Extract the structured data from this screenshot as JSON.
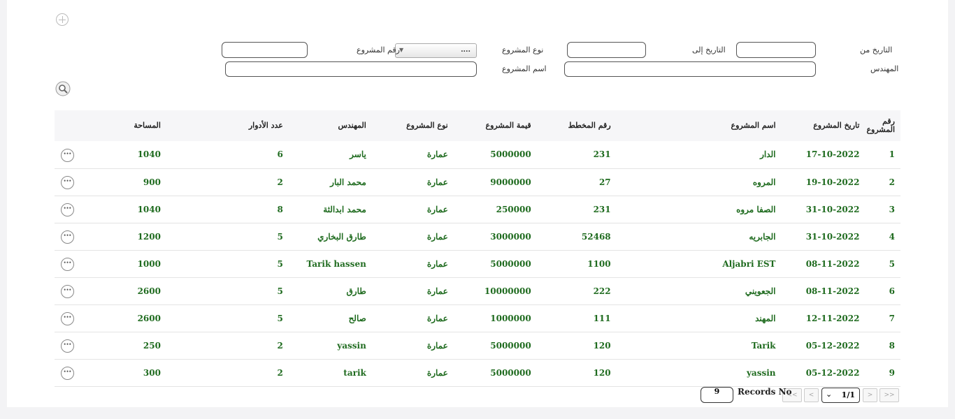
{
  "filters": {
    "date_from_label": "التاريخ من",
    "date_to_label": "التاريخ إلى",
    "project_type_label": "نوع المشروع",
    "project_no_label": "رقم المشروع",
    "engineer_label": "المهندس",
    "project_name_label": "اسم المشروع",
    "project_type_value": "...."
  },
  "table": {
    "headers": [
      "رقم المشروع",
      "تاريخ المشروع",
      "اسم المشروع",
      "رقم المخطط",
      "قيمة المشروع",
      "نوع المشروع",
      "المهندس",
      "عدد الأدوار",
      "المساحة"
    ],
    "rows": [
      {
        "no": "1",
        "date": "17-10-2022",
        "name": "الدار",
        "plan": "231",
        "value": "5000000",
        "type": "عمارة",
        "engineer": "ياسر",
        "floors": "6",
        "area": "1040"
      },
      {
        "no": "2",
        "date": "19-10-2022",
        "name": "المروه",
        "plan": "27",
        "value": "9000000",
        "type": "عمارة",
        "engineer": "محمد البار",
        "floors": "2",
        "area": "900"
      },
      {
        "no": "3",
        "date": "31-10-2022",
        "name": "الصفا مروه",
        "plan": "231",
        "value": "250000",
        "type": "عمارة",
        "engineer": "محمد ابدالثة",
        "floors": "8",
        "area": "1040"
      },
      {
        "no": "4",
        "date": "31-10-2022",
        "name": "الجابريه",
        "plan": "52468",
        "value": "3000000",
        "type": "عمارة",
        "engineer": "طارق البخاري",
        "floors": "5",
        "area": "1200"
      },
      {
        "no": "5",
        "date": "08-11-2022",
        "name": "Aljabri EST",
        "plan": "1100",
        "value": "5000000",
        "type": "عمارة",
        "engineer": "Tarik hassen",
        "floors": "5",
        "area": "1000"
      },
      {
        "no": "6",
        "date": "08-11-2022",
        "name": "الجعويني",
        "plan": "222",
        "value": "10000000",
        "type": "عمارة",
        "engineer": "طارق",
        "floors": "5",
        "area": "2600"
      },
      {
        "no": "7",
        "date": "12-11-2022",
        "name": "المهند",
        "plan": "111",
        "value": "1000000",
        "type": "عمارة",
        "engineer": "صالح",
        "floors": "5",
        "area": "2600"
      },
      {
        "no": "8",
        "date": "05-12-2022",
        "name": "Tarik",
        "plan": "120",
        "value": "5000000",
        "type": "عمارة",
        "engineer": "yassin",
        "floors": "2",
        "area": "250"
      },
      {
        "no": "9",
        "date": "05-12-2022",
        "name": "yassin",
        "plan": "120",
        "value": "5000000",
        "type": "عمارة",
        "engineer": "tarik",
        "floors": "2",
        "area": "300"
      }
    ]
  },
  "pager": {
    "first": "<<",
    "prev": "<",
    "page": "1/1",
    "next": ">",
    "last": ">>",
    "records_label": "Records No",
    "records_count": "9"
  },
  "icons": {
    "add": "plus-circle-icon",
    "search": "magnifier-icon",
    "row_menu": "ellipsis-icon"
  },
  "colors": {
    "project_name": "#e0217a",
    "cell_value": "#1f6b1f"
  }
}
